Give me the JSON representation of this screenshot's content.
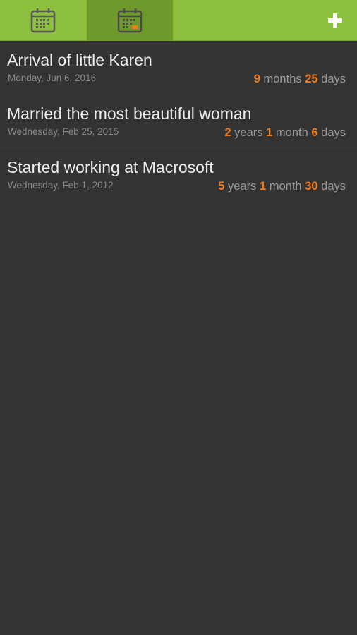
{
  "header": {
    "tabs": [
      {
        "icon": "calendar-icon",
        "selected": false
      },
      {
        "icon": "calendar-event-icon",
        "selected": true
      }
    ],
    "add_icon": "plus-icon"
  },
  "colors": {
    "header_green": "#8dc03f",
    "active_tab_green": "#6e9a2c",
    "accent_orange": "#f07a1a",
    "background": "#333333"
  },
  "events": [
    {
      "title": "Arrival of little Karen",
      "date": "Monday, Jun 6, 2016",
      "elapsed": {
        "n1": "9",
        "u1": "months",
        "n2": "25",
        "u2": "days",
        "n3": "",
        "u3": ""
      }
    },
    {
      "title": "Married the most beautiful woman",
      "date": "Wednesday, Feb 25, 2015",
      "elapsed": {
        "n1": "2",
        "u1": "years",
        "n2": "1",
        "u2": "month",
        "n3": "6",
        "u3": "days"
      }
    },
    {
      "title": "Started working at Macrosoft",
      "date": "Wednesday, Feb 1, 2012",
      "elapsed": {
        "n1": "5",
        "u1": "years",
        "n2": "1",
        "u2": "month",
        "n3": "30",
        "u3": "days"
      }
    }
  ]
}
